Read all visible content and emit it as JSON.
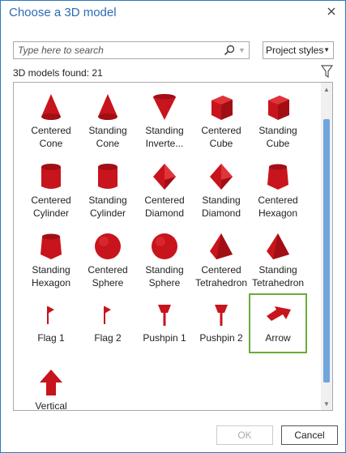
{
  "dialog": {
    "title": "Choose a 3D model",
    "search_placeholder": "Type here to search",
    "style_select": "Project styles",
    "count_text": "3D models found: 21",
    "ok_label": "OK",
    "cancel_label": "Cancel"
  },
  "items": [
    {
      "line1": "Centered",
      "line2": "Cone",
      "icon": "cone-icon"
    },
    {
      "line1": "Standing",
      "line2": "Cone",
      "icon": "cone-icon"
    },
    {
      "line1": "Standing",
      "line2": "Inverte...",
      "icon": "inverted-cone-icon"
    },
    {
      "line1": "Centered",
      "line2": "Cube",
      "icon": "cube-icon"
    },
    {
      "line1": "Standing",
      "line2": "Cube",
      "icon": "cube-icon"
    },
    {
      "line1": "Centered",
      "line2": "Cylinder",
      "icon": "cylinder-icon"
    },
    {
      "line1": "Standing",
      "line2": "Cylinder",
      "icon": "cylinder-icon"
    },
    {
      "line1": "Centered",
      "line2": "Diamond",
      "icon": "diamond-icon"
    },
    {
      "line1": "Standing",
      "line2": "Diamond",
      "icon": "diamond-icon"
    },
    {
      "line1": "Centered",
      "line2": "Hexagon",
      "icon": "hexagon-icon"
    },
    {
      "line1": "Standing",
      "line2": "Hexagon",
      "icon": "hexagon-icon"
    },
    {
      "line1": "Centered",
      "line2": "Sphere",
      "icon": "sphere-icon"
    },
    {
      "line1": "Standing",
      "line2": "Sphere",
      "icon": "sphere-icon"
    },
    {
      "line1": "Centered",
      "line2": "Tetrahedron",
      "icon": "tetrahedron-icon"
    },
    {
      "line1": "Standing",
      "line2": "Tetrahedron",
      "icon": "tetrahedron-icon"
    },
    {
      "line1": "Flag 1",
      "line2": "",
      "icon": "flag-icon"
    },
    {
      "line1": "Flag 2",
      "line2": "",
      "icon": "flag-icon"
    },
    {
      "line1": "Pushpin 1",
      "line2": "",
      "icon": "pushpin-icon"
    },
    {
      "line1": "Pushpin 2",
      "line2": "",
      "icon": "pushpin-icon"
    },
    {
      "line1": "Arrow",
      "line2": "",
      "icon": "arrow-icon",
      "selected": true
    },
    {
      "line1": "Vertical",
      "line2": "",
      "icon": "vertical-arrow-icon"
    }
  ],
  "colors": {
    "accent": "#2b6cb5",
    "model_red": "#c8141c",
    "selection": "#6aab3a",
    "scroll_thumb": "#6fa6dc"
  }
}
